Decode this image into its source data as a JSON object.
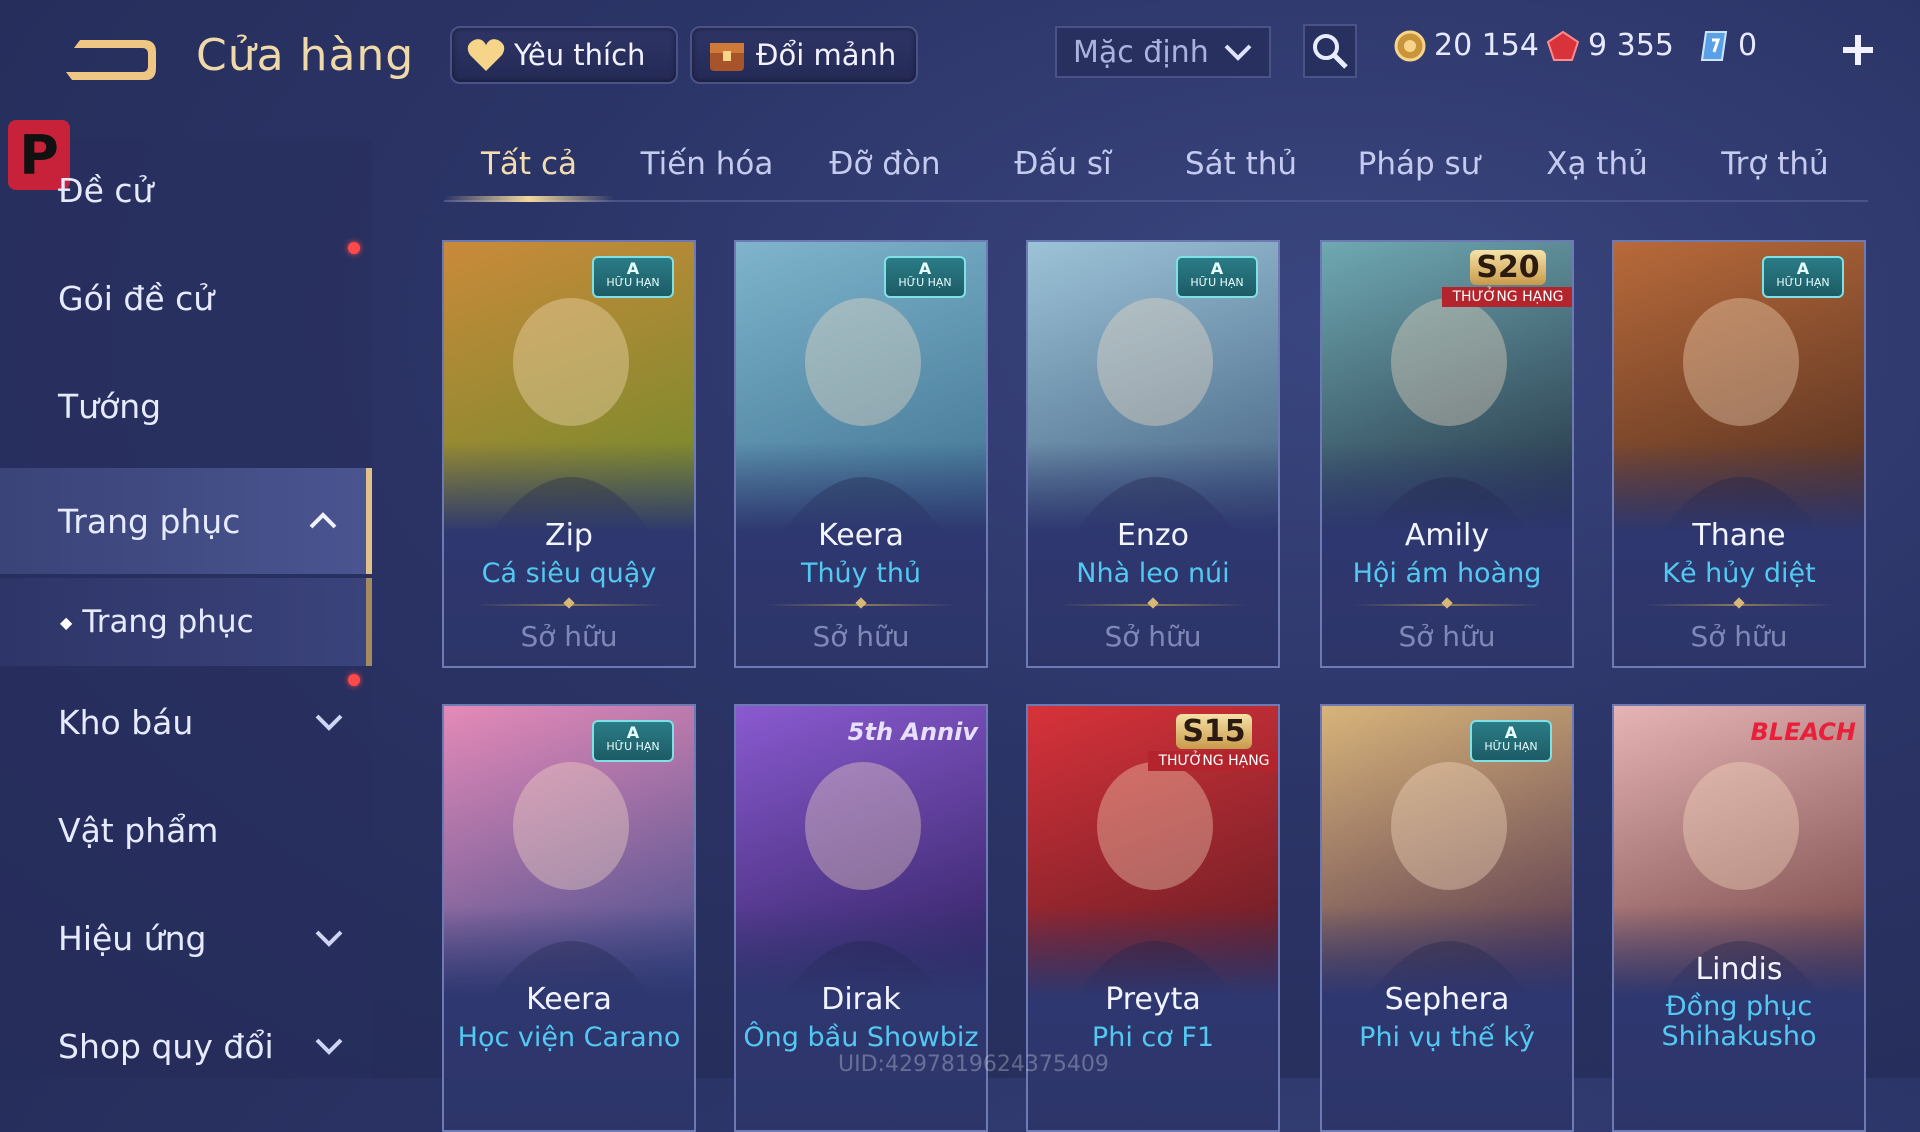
{
  "header": {
    "title": "Cửa hàng",
    "favorite_label": "Yêu thích",
    "shard_label": "Đổi mảnh",
    "sort_value": "Mặc định",
    "currencies": [
      {
        "icon": "gold-coin-icon",
        "value": "20 154"
      },
      {
        "icon": "red-gem-icon",
        "value": "9 355"
      },
      {
        "icon": "voucher-icon",
        "value": "0"
      }
    ]
  },
  "sidebar": {
    "items": [
      {
        "label": "Đề cử"
      },
      {
        "label": "Gói đề cử"
      },
      {
        "label": "Tướng"
      },
      {
        "label": "Trang phục"
      },
      {
        "label": "Trang phục"
      },
      {
        "label": "Kho báu"
      },
      {
        "label": "Vật phẩm"
      },
      {
        "label": "Hiệu ứng"
      },
      {
        "label": "Shop quy đổi"
      }
    ]
  },
  "tabs": [
    "Tất cả",
    "Tiến hóa",
    "Đỡ đòn",
    "Đấu sĩ",
    "Sát thủ",
    "Pháp sư",
    "Xạ thủ",
    "Trợ thủ"
  ],
  "cards": [
    {
      "name": "Zip",
      "skin": "Cá siêu quậy",
      "status": "Sở hữu",
      "tag": "A",
      "tag_sub": "HỮU HẠN",
      "art_colors": [
        "#c98a3a",
        "#6a8a2a"
      ]
    },
    {
      "name": "Keera",
      "skin": "Thủy thủ",
      "status": "Sở hữu",
      "tag": "A",
      "tag_sub": "HỮU HẠN",
      "art_colors": [
        "#7fb4cc",
        "#3b6f8e"
      ]
    },
    {
      "name": "Enzo",
      "skin": "Nhà leo núi",
      "status": "Sở hữu",
      "tag": "A",
      "tag_sub": "HỮU HẠN",
      "art_colors": [
        "#9cc3d8",
        "#3f5c7c"
      ]
    },
    {
      "name": "Amily",
      "skin": "Hội ám hoàng",
      "status": "Sở hữu",
      "tag": "S20",
      "tag_sub": "THƯỞNG HẠNG",
      "art_colors": [
        "#6fa9b2",
        "#1e2a3c"
      ]
    },
    {
      "name": "Thane",
      "skin": "Kẻ hủy diệt",
      "status": "Sở hữu",
      "tag": "A",
      "tag_sub": "HỮU HẠN",
      "art_colors": [
        "#b86a3a",
        "#4a2a1e"
      ]
    },
    {
      "name": "Keera",
      "skin": "Học viện Carano",
      "status": "",
      "tag": "A",
      "tag_sub": "HỮU HẠN",
      "art_colors": [
        "#e58ab8",
        "#3a4a8a"
      ]
    },
    {
      "name": "Dirak",
      "skin": "Ông bầu Showbiz",
      "status": "",
      "tag": "5th Anniv",
      "tag_sub": "",
      "art_colors": [
        "#8a5ad0",
        "#2a1e5a"
      ]
    },
    {
      "name": "Preyta",
      "skin": "Phi cơ F1",
      "status": "",
      "tag": "S15",
      "tag_sub": "THƯỞNG HẠNG",
      "art_colors": [
        "#d8323a",
        "#5a1a22"
      ]
    },
    {
      "name": "Sephera",
      "skin": "Phi vụ thế kỷ",
      "status": "",
      "tag": "A",
      "tag_sub": "HỮU HẠN",
      "art_colors": [
        "#d8b47a",
        "#4a2a4a"
      ]
    },
    {
      "name": "Lindis",
      "skin": "Đồng phục Shihakusho",
      "status": "",
      "tag": "BLEACH",
      "tag_sub": "",
      "art_colors": [
        "#e6b4b4",
        "#6a3a3a"
      ]
    }
  ],
  "uid_text": "UID:4297819624375409"
}
